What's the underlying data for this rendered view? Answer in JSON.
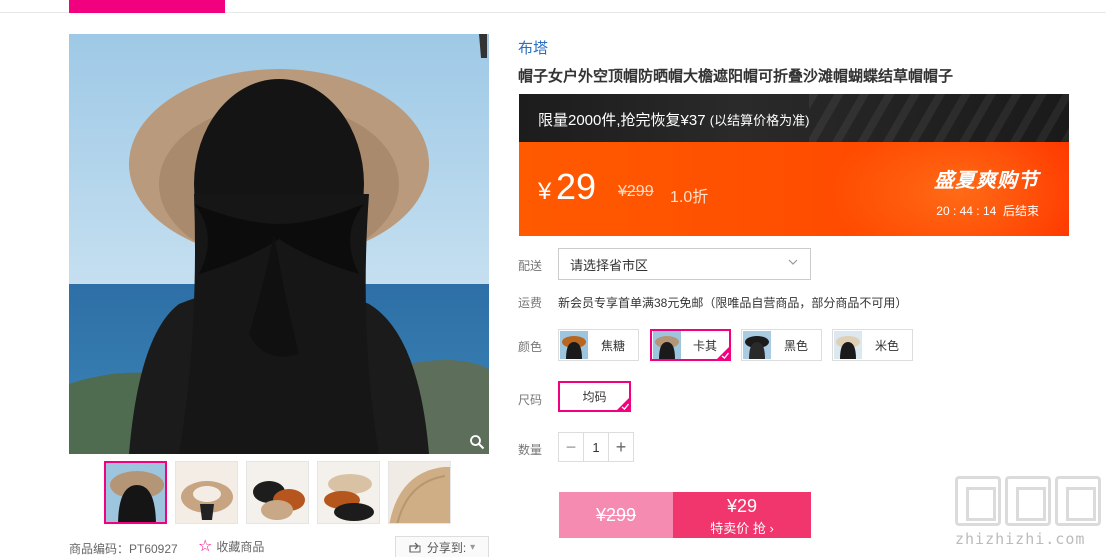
{
  "brand": "布塔",
  "title": "帽子女户外空顶帽防晒帽大檐遮阳帽可折叠沙滩帽蝴蝶结草帽帽子",
  "promo": {
    "text": "限量2000件,抢完恢复¥37",
    "note": "(以结算价格为准)"
  },
  "price": {
    "currency": "¥",
    "now": "29",
    "old": "¥299",
    "discount": "1.0折"
  },
  "event": {
    "name": "盛夏爽购节",
    "countdown": "20 : 44 : 14",
    "countdown_suffix": "后结束"
  },
  "delivery": {
    "label": "配送",
    "placeholder": "请选择省市区"
  },
  "shipping": {
    "label": "运费",
    "text": "新会员专享首单满38元免邮（限唯品自营商品，部分商品不可用）"
  },
  "colors": {
    "label": "颜色",
    "options": [
      {
        "name": "焦糖",
        "selected": false
      },
      {
        "name": "卡其",
        "selected": true
      },
      {
        "name": "黑色",
        "selected": false
      },
      {
        "name": "米色",
        "selected": false
      }
    ]
  },
  "size": {
    "label": "尺码",
    "option": "均码"
  },
  "quantity": {
    "label": "数量",
    "value": "1",
    "minus": "−",
    "plus": "+"
  },
  "buy": {
    "old_price": "¥299",
    "price": "¥29",
    "action": "特卖价 抢 ›"
  },
  "gallery": {
    "product_code": "商品编码：PT60927",
    "favorite": "收藏商品",
    "share": "分享到:"
  },
  "watermark": {
    "text": "zhizhizhi.com"
  },
  "icons": {
    "zoom": "magnifier-icon",
    "star": "star-outline-icon",
    "share": "share-icon",
    "chevron": "chevron-down-icon",
    "check": "check-corner-icon"
  },
  "colors_theme": {
    "accent": "#f10180",
    "promo_orange": "#ff4d00",
    "buy_pink": "#f0366d",
    "link_blue": "#2b6fc0"
  }
}
